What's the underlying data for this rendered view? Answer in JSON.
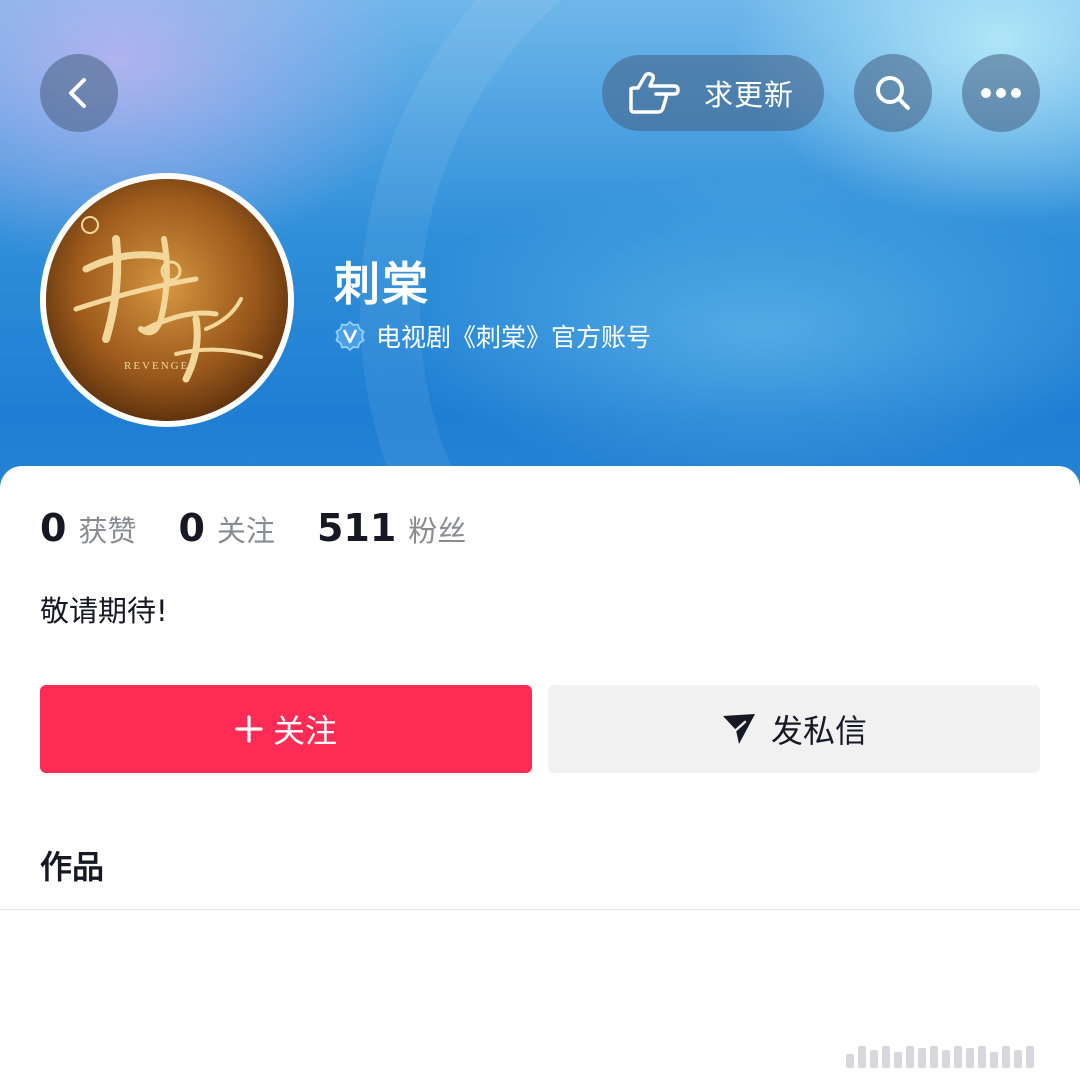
{
  "header": {
    "back_icon": "chevron-left-icon",
    "request_update": {
      "icon": "pointing-hand-icon",
      "label": "求更新"
    },
    "search_icon": "search-icon",
    "more_icon": "more-dots-icon"
  },
  "profile": {
    "avatar": {
      "title_logo": "刺棠",
      "subtitle_logo": "REVENGE"
    },
    "name": "刺棠",
    "verified_icon": "verified-v-icon",
    "verified_text": "电视剧《刺棠》官方账号"
  },
  "stats": [
    {
      "value": "0",
      "label": "获赞"
    },
    {
      "value": "0",
      "label": "关注"
    },
    {
      "value": "511",
      "label": "粉丝"
    }
  ],
  "bio": "敬请期待!",
  "actions": {
    "follow_label": "关注",
    "message_label": "发私信"
  },
  "tabs": {
    "works": "作品"
  },
  "colors": {
    "accent": "#fe2c55",
    "header_blue": "#2f8fd9",
    "text_primary": "#161823",
    "text_secondary": "#8a8b91"
  }
}
